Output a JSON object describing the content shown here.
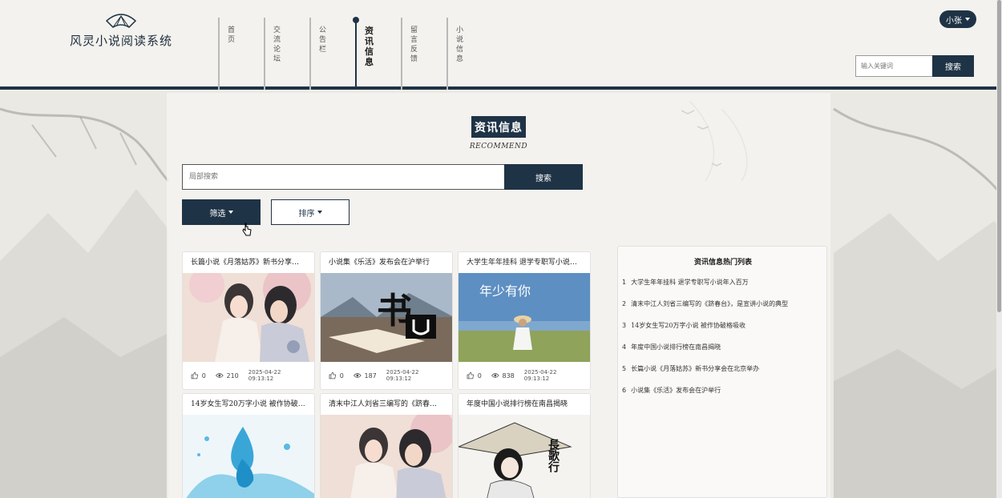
{
  "brand": {
    "name": "风灵小说阅读系统",
    "logo_icon": "fan-logo-icon"
  },
  "nav": [
    {
      "label": "首页",
      "active": false
    },
    {
      "label": "交流论坛",
      "active": false
    },
    {
      "label": "公告栏",
      "active": false
    },
    {
      "label": "资讯信息",
      "active": true
    },
    {
      "label": "留言反馈",
      "active": false
    },
    {
      "label": "小说信息",
      "active": false
    }
  ],
  "user": {
    "name": "小张"
  },
  "top_search": {
    "placeholder": "输入关键词",
    "button": "搜索"
  },
  "section": {
    "title": "资讯信息",
    "subtitle": "RECOMMEND"
  },
  "local_search": {
    "placeholder": "局部搜索",
    "button": "搜索"
  },
  "filter": {
    "label": "筛选"
  },
  "sort": {
    "label": "排序"
  },
  "cards": [
    {
      "title": "长篇小说《月落姑苏》新书分享会在北京举办",
      "likes": "0",
      "views": "210",
      "date": "2025-04-22 09:13:12",
      "image": "ancient-couple-painting"
    },
    {
      "title": "小说集《乐活》发布会在沪举行",
      "likes": "0",
      "views": "187",
      "date": "2025-04-22 09:13:12",
      "image": "calligraphy-book-art"
    },
    {
      "title": "大学生年年挂科 退学专职写小说年入百万",
      "likes": "0",
      "views": "838",
      "date": "2025-04-22 09:13:12",
      "image": "young-with-you-cover"
    },
    {
      "title": "14岁女生写20万字小说 被作协破格吸收",
      "image": "blue-water-drop"
    },
    {
      "title": "清末中江人刘省三编写的《跻春台》，是宣讲小说的典型",
      "image": "ancient-couple-painting-2"
    },
    {
      "title": "年度中国小说排行榜在南昌揭晓",
      "image": "changgexing-cover"
    }
  ],
  "hot": {
    "title": "资讯信息热门列表",
    "items": [
      {
        "num": "1",
        "text": "大学生年年挂科 退学专职写小说年入百万"
      },
      {
        "num": "2",
        "text": "清末中江人刘省三编写的《跻春台》，是宣讲小说的典型"
      },
      {
        "num": "3",
        "text": "14岁女生写20万字小说 被作协破格吸收"
      },
      {
        "num": "4",
        "text": "年度中国小说排行榜在南昌揭晓"
      },
      {
        "num": "5",
        "text": "长篇小说《月落姑苏》新书分享会在北京举办"
      },
      {
        "num": "6",
        "text": "小说集《乐活》发布会在沪举行"
      }
    ]
  },
  "cover_text": {
    "card2": "书",
    "card3": "年少有你",
    "card6": "長歌行"
  },
  "colors": {
    "primary": "#1f3346",
    "background": "#eceae4",
    "panel": "#f6f5f1"
  }
}
